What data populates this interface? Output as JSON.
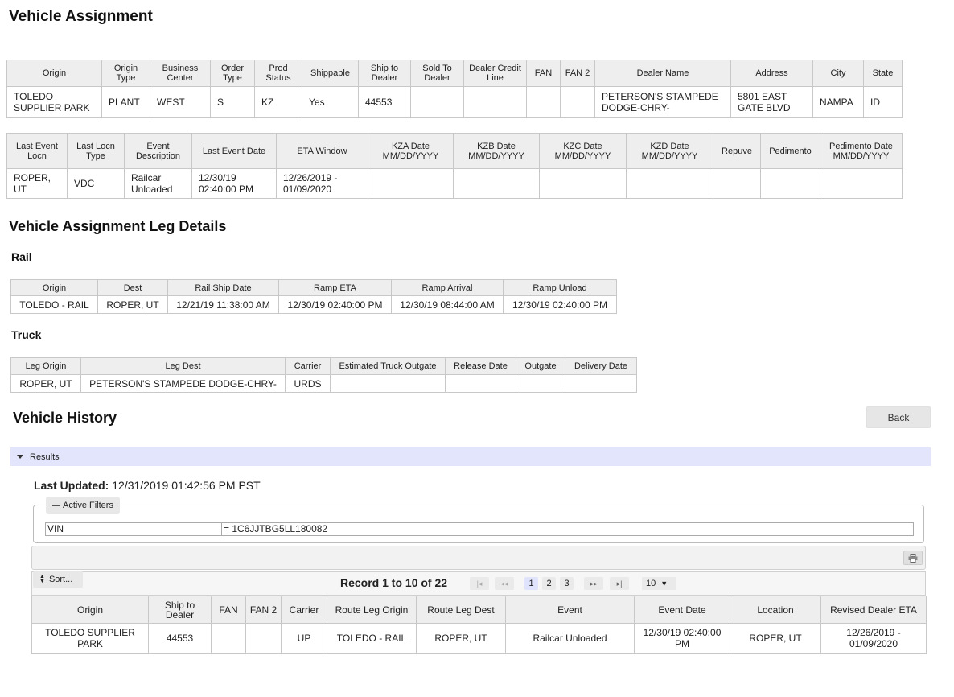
{
  "page_title": "Vehicle Assignment",
  "assignment": {
    "headers": [
      "Origin",
      "Origin Type",
      "Business Center",
      "Order Type",
      "Prod Status",
      "Shippable",
      "Ship to Dealer",
      "Sold To Dealer",
      "Dealer Credit Line",
      "FAN",
      "FAN 2",
      "Dealer Name",
      "Address",
      "City",
      "State"
    ],
    "row": [
      "TOLEDO SUPPLIER PARK",
      "PLANT",
      "WEST",
      "S",
      "KZ",
      "Yes",
      "44553",
      "",
      "",
      "",
      "",
      "PETERSON'S STAMPEDE DODGE-CHRY-",
      "5801 EAST GATE BLVD",
      "NAMPA",
      "ID"
    ]
  },
  "events": {
    "headers": [
      "Last Event Locn",
      "Last Locn Type",
      "Event Description",
      "Last Event Date",
      "ETA Window",
      "KZA Date MM/DD/YYYY",
      "KZB Date MM/DD/YYYY",
      "KZC Date MM/DD/YYYY",
      "KZD Date MM/DD/YYYY",
      "Repuve",
      "Pedimento",
      "Pedimento Date MM/DD/YYYY"
    ],
    "row": [
      "ROPER, UT",
      "VDC",
      "Railcar Unloaded",
      "12/30/19 02:40:00 PM",
      "12/26/2019 - 01/09/2020",
      "",
      "",
      "",
      "",
      "",
      "",
      ""
    ]
  },
  "leg_details_title": "Vehicle Assignment Leg Details",
  "rail": {
    "title": "Rail",
    "headers": [
      "Origin",
      "Dest",
      "Rail Ship Date",
      "Ramp ETA",
      "Ramp Arrival",
      "Ramp Unload"
    ],
    "row": [
      "TOLEDO - RAIL",
      "ROPER, UT",
      "12/21/19 11:38:00 AM",
      "12/30/19 02:40:00 PM",
      "12/30/19 08:44:00 AM",
      "12/30/19 02:40:00 PM"
    ]
  },
  "truck": {
    "title": "Truck",
    "headers": [
      "Leg Origin",
      "Leg Dest",
      "Carrier",
      "Estimated Truck Outgate",
      "Release Date",
      "Outgate",
      "Delivery Date"
    ],
    "row": [
      "ROPER, UT",
      "PETERSON'S STAMPEDE DODGE-CHRY-",
      "URDS",
      "",
      "",
      "",
      ""
    ]
  },
  "history": {
    "title": "Vehicle History",
    "back_label": "Back",
    "results_label": "Results",
    "last_updated_label": "Last Updated:",
    "last_updated_value": "12/31/2019 01:42:56 PM PST",
    "active_filters_label": "Active Filters",
    "filter_key": "VIN",
    "filter_value": "= 1C6JJTBG5LL180082",
    "sort_label": "Sort...",
    "record_text": "Record 1 to 10 of 22",
    "pages": [
      "1",
      "2",
      "3"
    ],
    "current_page": "1",
    "page_size": "10",
    "icons": {
      "first": "first-page-icon",
      "prev": "prev-page-icon",
      "next": "next-page-icon",
      "last": "last-page-icon",
      "print": "print-icon"
    },
    "headers": [
      "Origin",
      "Ship to Dealer",
      "FAN",
      "FAN 2",
      "Carrier",
      "Route Leg Origin",
      "Route Leg Dest",
      "Event",
      "Event Date",
      "Location",
      "Revised Dealer ETA"
    ],
    "rows": [
      [
        "TOLEDO SUPPLIER PARK",
        "44553",
        "",
        "",
        "UP",
        "TOLEDO - RAIL",
        "ROPER, UT",
        "Railcar Unloaded",
        "12/30/19 02:40:00 PM",
        "ROPER, UT",
        "12/26/2019 - 01/09/2020"
      ]
    ]
  },
  "colors": {
    "results_bar": "#e2e5fb",
    "header_bg": "#eeeeee",
    "border": "#c8c8c8"
  }
}
